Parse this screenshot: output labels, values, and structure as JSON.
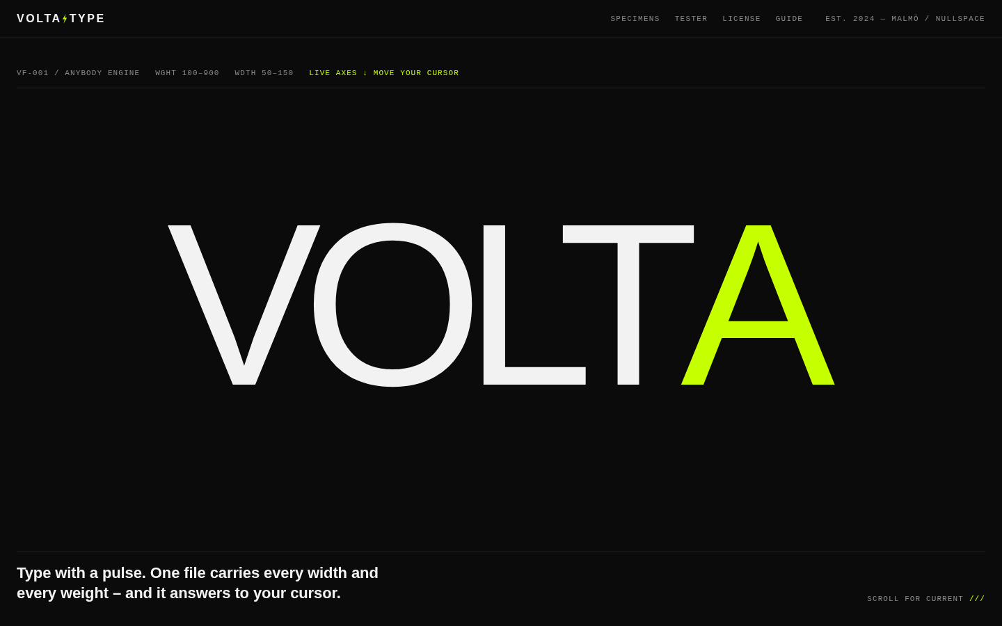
{
  "header": {
    "logo": {
      "left": "VOLTA",
      "right": "TYPE"
    },
    "nav": [
      "SPECIMENS",
      "TESTER",
      "LICENSE",
      "GUIDE"
    ],
    "location": "EST. 2024 — MALMÖ / NULLSPACE"
  },
  "meta": {
    "tags": [
      "VF-001 / ANYBODY ENGINE",
      "WGHT 100–900",
      "WDTH 50–150"
    ],
    "live_hint": "LIVE AXES ↓ MOVE YOUR CURSOR"
  },
  "hero": {
    "parts": [
      {
        "text": "VOLT",
        "accent": false
      },
      {
        "text": "A",
        "accent": true
      }
    ]
  },
  "footer": {
    "tagline": "Type with a pulse. One file carries every width and every weight – and it answers to your cursor.",
    "scroll_hint": {
      "label": "SCROLL FOR CURRENT",
      "mark": "///"
    }
  }
}
